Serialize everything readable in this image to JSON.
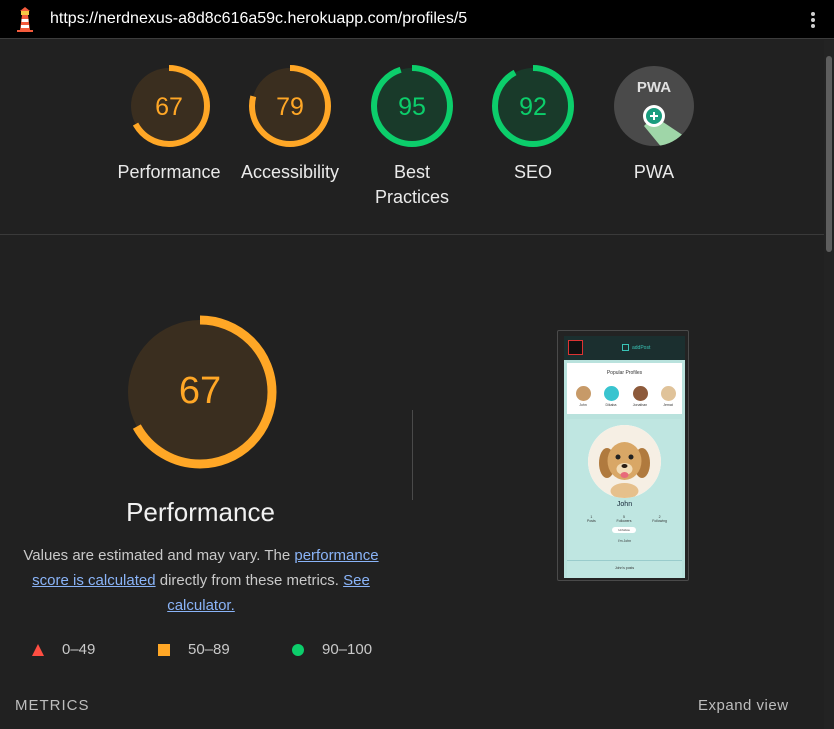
{
  "browser": {
    "url": "https://nerdnexus-a8d8c616a59c.herokuapp.com/profiles/5"
  },
  "colors": {
    "average": "#ffa726",
    "pass": "#0cce6b",
    "fail": "#ff4e42",
    "link": "#8ab4f8"
  },
  "gauges": [
    {
      "score": "67",
      "label": "Performance",
      "value": 67,
      "status": "average"
    },
    {
      "score": "79",
      "label": "Accessibility",
      "value": 79,
      "status": "average"
    },
    {
      "score": "95",
      "label": "Best Practices",
      "value": 95,
      "status": "pass"
    },
    {
      "score": "92",
      "label": "SEO",
      "value": 92,
      "status": "pass"
    },
    {
      "score": "",
      "label": "PWA",
      "badge_text": "PWA",
      "icon": "pwa-badge-icon"
    }
  ],
  "performance": {
    "score": "67",
    "value": 67,
    "title": "Performance",
    "desc_prefix": "Values are estimated and may vary. The ",
    "desc_link1": "performance score is calculated",
    "desc_middle": " directly from these metrics. ",
    "desc_link2": "See calculator."
  },
  "legend": [
    {
      "range": "0–49",
      "icon": "triangle-fail-icon"
    },
    {
      "range": "50–89",
      "icon": "square-average-icon"
    },
    {
      "range": "90–100",
      "icon": "circle-pass-icon"
    }
  ],
  "screenshot": {
    "nav_text": "addPost",
    "popular_title": "Popular Profiles",
    "popular": [
      "John",
      "Dikaba",
      "Jonathan",
      "Jemat"
    ],
    "profile_name": "John",
    "stats": [
      {
        "value": "1",
        "label": "Posts"
      },
      {
        "value": "5",
        "label": "Followers"
      },
      {
        "value": "2",
        "label": "Following"
      }
    ],
    "button": "Unfollow",
    "bio": "I'm John",
    "posts_title": "John's posts"
  },
  "metrics_label": "METRICS",
  "expand_label": "Expand view"
}
